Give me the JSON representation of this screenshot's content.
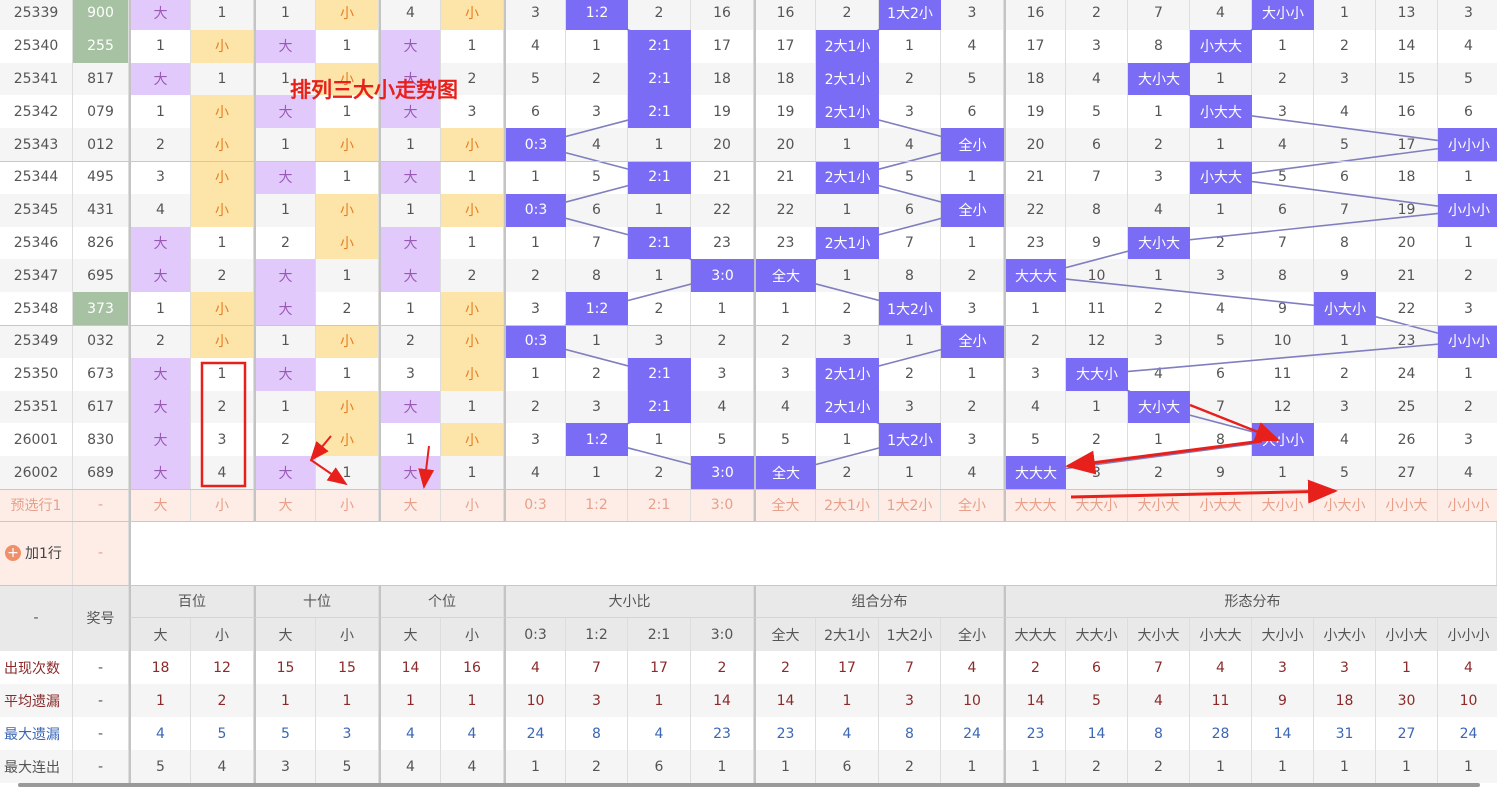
{
  "title": "排列三大小走势图",
  "colors": {
    "hit": "#7b6cf6",
    "line": "#7f7fc0",
    "da": "#e2c9fb",
    "xiao": "#fde4a8",
    "annotation": "#e8201c"
  },
  "rows": [
    {
      "period": "25339",
      "number": "900",
      "hl": true,
      "cells": [
        "大",
        "1",
        "1",
        "小",
        "4",
        "小",
        "3",
        "1:2",
        "2",
        "16",
        "16",
        "2",
        "1大2小",
        "3",
        "16",
        "2",
        "7",
        "4",
        "大小小",
        "1",
        "13",
        "3"
      ]
    },
    {
      "period": "25340",
      "number": "255",
      "hl": true,
      "cells": [
        "1",
        "小",
        "大",
        "1",
        "大",
        "1",
        "4",
        "1",
        "2:1",
        "17",
        "17",
        "2大1小",
        "1",
        "4",
        "17",
        "3",
        "8",
        "小大大",
        "1",
        "2",
        "14",
        "4"
      ]
    },
    {
      "period": "25341",
      "number": "817",
      "hl": false,
      "cells": [
        "大",
        "1",
        "1",
        "小",
        "大",
        "2",
        "5",
        "2",
        "2:1",
        "18",
        "18",
        "2大1小",
        "2",
        "5",
        "18",
        "4",
        "大小大",
        "1",
        "2",
        "3",
        "15",
        "5"
      ]
    },
    {
      "period": "25342",
      "number": "079",
      "hl": false,
      "cells": [
        "1",
        "小",
        "大",
        "1",
        "大",
        "3",
        "6",
        "3",
        "2:1",
        "19",
        "19",
        "2大1小",
        "3",
        "6",
        "19",
        "5",
        "1",
        "小大大",
        "3",
        "4",
        "16",
        "6"
      ]
    },
    {
      "period": "25343",
      "number": "012",
      "hl": false,
      "cells": [
        "2",
        "小",
        "1",
        "小",
        "1",
        "小",
        "0:3",
        "4",
        "1",
        "20",
        "20",
        "1",
        "4",
        "全小",
        "20",
        "6",
        "2",
        "1",
        "4",
        "5",
        "17",
        "小小小"
      ]
    },
    {
      "period": "25344",
      "number": "495",
      "hl": false,
      "cells": [
        "3",
        "小",
        "大",
        "1",
        "大",
        "1",
        "1",
        "5",
        "2:1",
        "21",
        "21",
        "2大1小",
        "5",
        "1",
        "21",
        "7",
        "3",
        "小大大",
        "5",
        "6",
        "18",
        "1"
      ]
    },
    {
      "period": "25345",
      "number": "431",
      "hl": false,
      "cells": [
        "4",
        "小",
        "1",
        "小",
        "1",
        "小",
        "0:3",
        "6",
        "1",
        "22",
        "22",
        "1",
        "6",
        "全小",
        "22",
        "8",
        "4",
        "1",
        "6",
        "7",
        "19",
        "小小小"
      ]
    },
    {
      "period": "25346",
      "number": "826",
      "hl": false,
      "cells": [
        "大",
        "1",
        "2",
        "小",
        "大",
        "1",
        "1",
        "7",
        "2:1",
        "23",
        "23",
        "2大1小",
        "7",
        "1",
        "23",
        "9",
        "大小大",
        "2",
        "7",
        "8",
        "20",
        "1"
      ]
    },
    {
      "period": "25347",
      "number": "695",
      "hl": false,
      "cells": [
        "大",
        "2",
        "大",
        "1",
        "大",
        "2",
        "2",
        "8",
        "1",
        "3:0",
        "全大",
        "1",
        "8",
        "2",
        "大大大",
        "10",
        "1",
        "3",
        "8",
        "9",
        "21",
        "2"
      ]
    },
    {
      "period": "25348",
      "number": "373",
      "hl": true,
      "cells": [
        "1",
        "小",
        "大",
        "2",
        "1",
        "小",
        "3",
        "1:2",
        "2",
        "1",
        "1",
        "2",
        "1大2小",
        "3",
        "1",
        "11",
        "2",
        "4",
        "9",
        "小大小",
        "22",
        "3"
      ]
    },
    {
      "period": "25349",
      "number": "032",
      "hl": false,
      "cells": [
        "2",
        "小",
        "1",
        "小",
        "2",
        "小",
        "0:3",
        "1",
        "3",
        "2",
        "2",
        "3",
        "1",
        "全小",
        "2",
        "12",
        "3",
        "5",
        "10",
        "1",
        "23",
        "小小小"
      ]
    },
    {
      "period": "25350",
      "number": "673",
      "hl": false,
      "cells": [
        "大",
        "1",
        "大",
        "1",
        "3",
        "小",
        "1",
        "2",
        "2:1",
        "3",
        "3",
        "2大1小",
        "2",
        "1",
        "3",
        "大大小",
        "4",
        "6",
        "11",
        "2",
        "24",
        "1"
      ]
    },
    {
      "period": "25351",
      "number": "617",
      "hl": false,
      "cells": [
        "大",
        "2",
        "1",
        "小",
        "大",
        "1",
        "2",
        "3",
        "2:1",
        "4",
        "4",
        "2大1小",
        "3",
        "2",
        "4",
        "1",
        "大小大",
        "7",
        "12",
        "3",
        "25",
        "2"
      ]
    },
    {
      "period": "26001",
      "number": "830",
      "hl": false,
      "cells": [
        "大",
        "3",
        "2",
        "小",
        "1",
        "小",
        "3",
        "1:2",
        "1",
        "5",
        "5",
        "1",
        "1大2小",
        "3",
        "5",
        "2",
        "1",
        "8",
        "大小小",
        "4",
        "26",
        "3"
      ]
    },
    {
      "period": "26002",
      "number": "689",
      "hl": false,
      "cells": [
        "大",
        "4",
        "大",
        "1",
        "大",
        "1",
        "4",
        "1",
        "2",
        "3:0",
        "全大",
        "2",
        "1",
        "4",
        "大大大",
        "3",
        "2",
        "9",
        "1",
        "5",
        "27",
        "4"
      ]
    }
  ],
  "preselect": {
    "label": "预选行1",
    "number": "-",
    "cells": [
      "大",
      "小",
      "大",
      "小",
      "大",
      "小",
      "0:3",
      "1:2",
      "2:1",
      "3:0",
      "全大",
      "2大1小",
      "1大2小",
      "全小",
      "大大大",
      "大大小",
      "大小大",
      "小大大",
      "大小小",
      "小大小",
      "小小大",
      "小小小"
    ]
  },
  "add_row": {
    "icon": "plus-circle-icon",
    "label": "加1行",
    "number": "-"
  },
  "header": {
    "corner": "-",
    "number": "奖号",
    "groups": [
      "百位",
      "十位",
      "个位",
      "大小比",
      "组合分布",
      "形态分布"
    ],
    "subs": [
      "大",
      "小",
      "大",
      "小",
      "大",
      "小",
      "0:3",
      "1:2",
      "2:1",
      "3:0",
      "全大",
      "2大1小",
      "1大2小",
      "全小",
      "大大大",
      "大大小",
      "大小大",
      "小大大",
      "大小小",
      "小大小",
      "小小大",
      "小小小"
    ]
  },
  "stats": [
    {
      "label": "出现次数",
      "number": "-",
      "style": "red",
      "values": [
        "18",
        "12",
        "15",
        "15",
        "14",
        "16",
        "4",
        "7",
        "17",
        "2",
        "2",
        "17",
        "7",
        "4",
        "2",
        "6",
        "7",
        "4",
        "3",
        "3",
        "1",
        "4"
      ]
    },
    {
      "label": "平均遗漏",
      "number": "-",
      "style": "red",
      "values": [
        "1",
        "2",
        "1",
        "1",
        "1",
        "1",
        "10",
        "3",
        "1",
        "14",
        "14",
        "1",
        "3",
        "10",
        "14",
        "5",
        "4",
        "11",
        "9",
        "18",
        "30",
        "10"
      ]
    },
    {
      "label": "最大遗漏",
      "number": "-",
      "style": "blue",
      "values": [
        "4",
        "5",
        "5",
        "3",
        "4",
        "4",
        "24",
        "8",
        "4",
        "23",
        "23",
        "4",
        "8",
        "24",
        "23",
        "14",
        "8",
        "28",
        "14",
        "31",
        "27",
        "24"
      ]
    },
    {
      "label": "最大连出",
      "number": "-",
      "style": "plain",
      "values": [
        "5",
        "4",
        "3",
        "5",
        "4",
        "4",
        "1",
        "2",
        "6",
        "1",
        "1",
        "6",
        "2",
        "1",
        "1",
        "2",
        "2",
        "1",
        "1",
        "1",
        "1",
        "1"
      ]
    }
  ]
}
